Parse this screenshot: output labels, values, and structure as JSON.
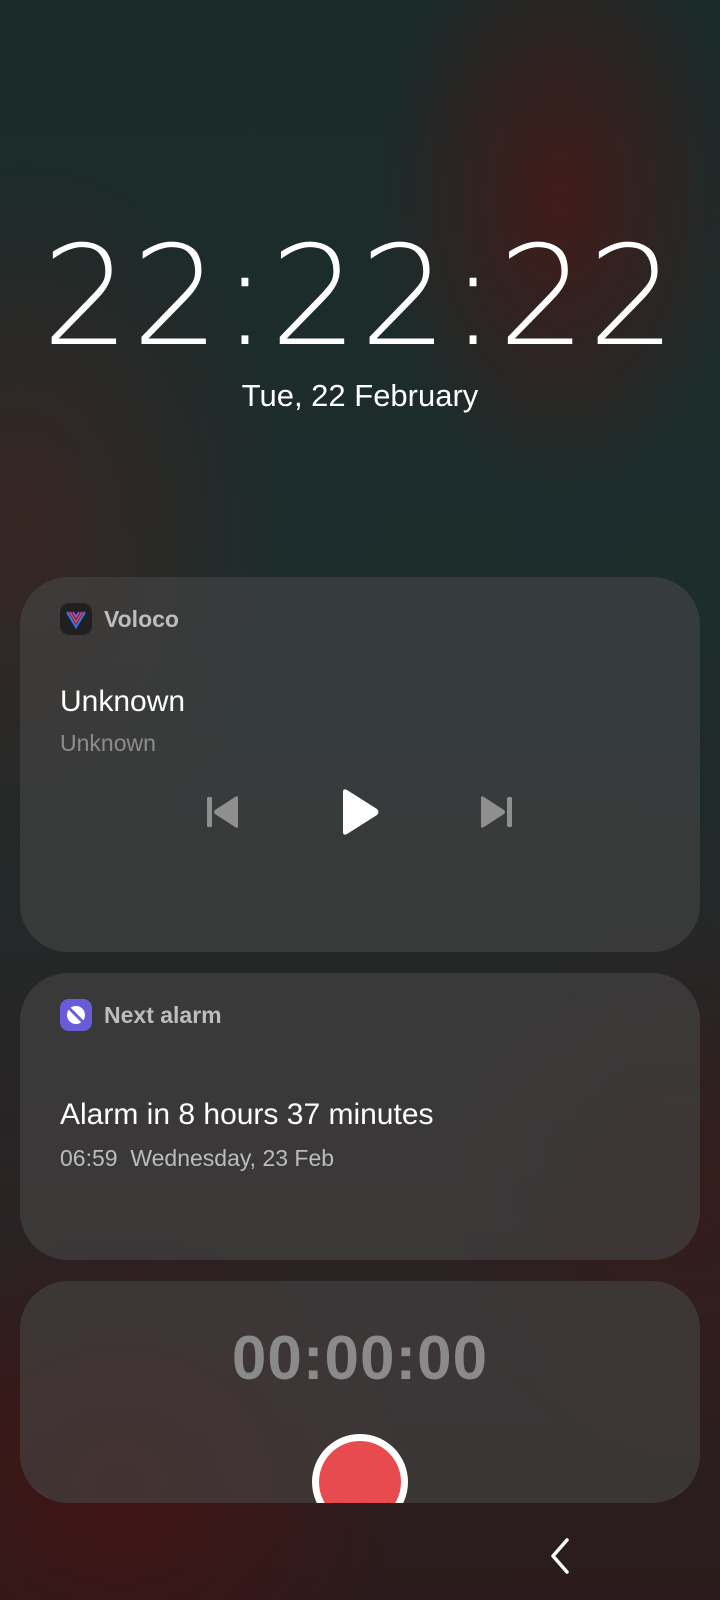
{
  "lockscreen": {
    "time": "22:22:22",
    "date": "Tue, 22 February"
  },
  "media": {
    "app_name": "Voloco",
    "app_icon": "voloco-logo-icon",
    "track_title": "Unknown",
    "track_artist": "Unknown",
    "controls": {
      "previous_icon": "skip-previous-icon",
      "play_icon": "play-icon",
      "next_icon": "skip-next-icon"
    }
  },
  "alarm": {
    "app_name": "Next alarm",
    "app_icon": "alarm-off-icon",
    "title": "Alarm in 8 hours 37 minutes",
    "time": "06:59",
    "day": "Wednesday, 23 Feb"
  },
  "recorder": {
    "elapsed": "00:00:00",
    "record_icon": "record-icon",
    "record_color": "#e84b4e"
  },
  "navigation": {
    "back_icon": "back-chevron-icon"
  },
  "colors": {
    "card_background": "#464646",
    "secondary_text": "#8d8d8d",
    "alarm_accent": "#6a5bd8"
  }
}
